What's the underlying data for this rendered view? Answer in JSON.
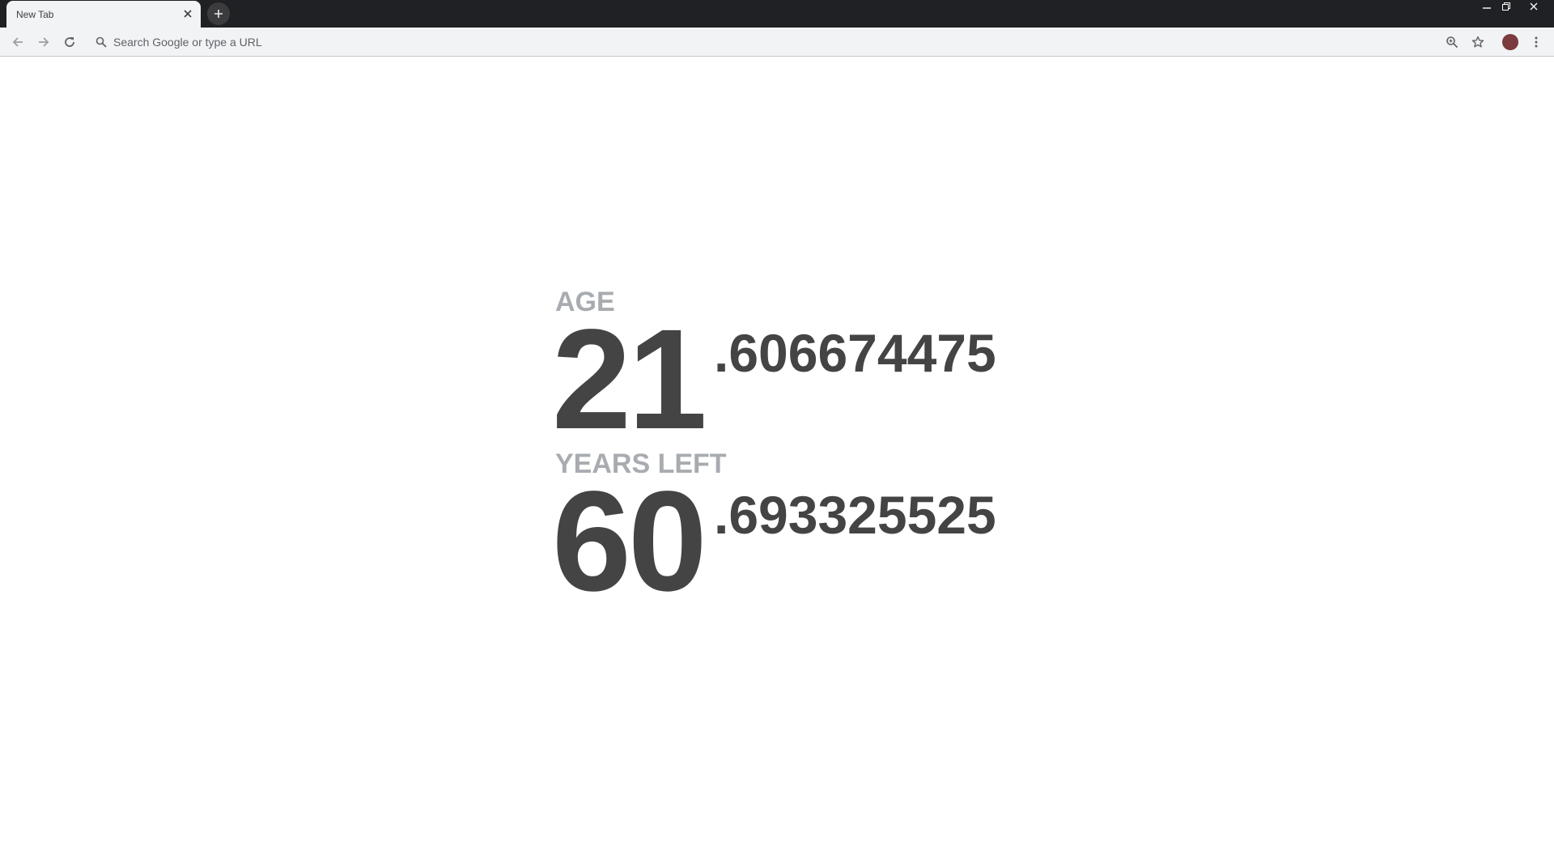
{
  "browser": {
    "tab": {
      "title": "New Tab"
    },
    "omnibox": {
      "placeholder": "Search Google or type a URL"
    },
    "colors": {
      "tabstrip": "#202124",
      "toolbar": "#f1f3f4",
      "avatar": "#7b3a3e"
    },
    "icons": {
      "tab_close": "close-icon",
      "new_tab": "plus-icon",
      "back": "arrow-left-icon",
      "forward": "arrow-right-icon",
      "reload": "reload-icon",
      "search": "search-icon",
      "zoom": "zoom-icon",
      "bookmark": "star-icon",
      "menu": "kebab-menu-icon",
      "minimize": "minimize-icon",
      "restore": "restore-icon",
      "close_window": "close-icon"
    }
  },
  "page": {
    "age": {
      "label": "AGE",
      "integer": "21",
      "fraction": ".606674475"
    },
    "years_left": {
      "label": "YEARS LEFT",
      "integer": "60",
      "fraction": ".693325525"
    },
    "colors": {
      "label": "#a8acb1",
      "number": "#444444"
    }
  }
}
